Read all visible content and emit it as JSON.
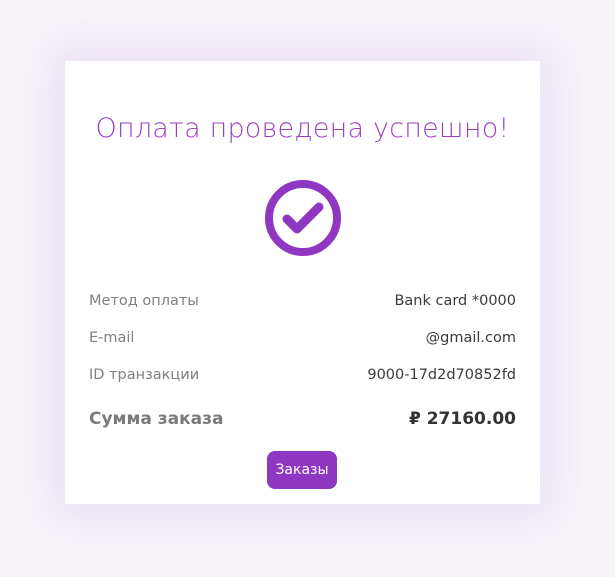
{
  "title": "Оплата проведена успешно!",
  "icon": "check-circle-icon",
  "colors": {
    "accent": "#8f36c2",
    "title": "#9a3fc0",
    "page_background": "#f7f4f9",
    "card_background": "#ffffff"
  },
  "details": {
    "method": {
      "label": "Метод оплаты",
      "value": "Bank card *0000"
    },
    "email": {
      "label": "E-mail",
      "value": "@gmail.com"
    },
    "transaction": {
      "label": "ID транзакции",
      "value": "9000-17d2d70852fd"
    },
    "total": {
      "label": "Сумма заказа",
      "value": "₽ 27160.00"
    }
  },
  "orders_button": "Заказы"
}
